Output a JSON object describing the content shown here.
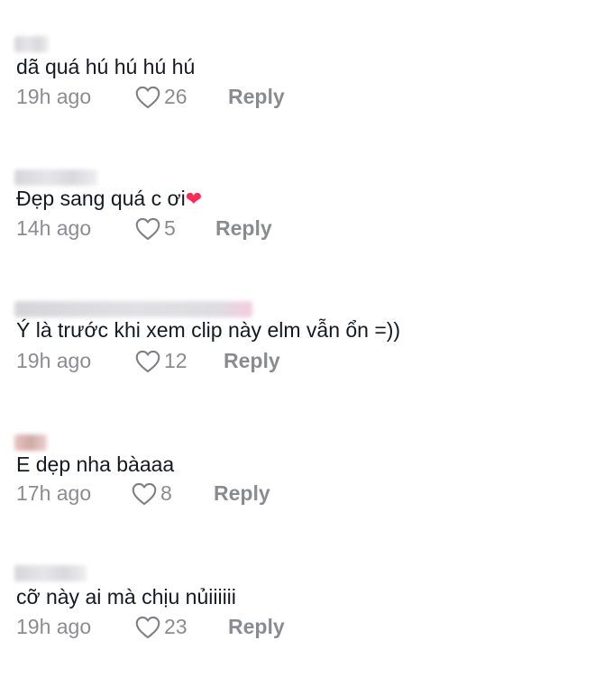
{
  "comments": [
    {
      "text": "dã quá hú hú hú hú",
      "time": "19h ago",
      "likes": "26",
      "reply": "Reply"
    },
    {
      "text": "Đẹp sang quá c ơi",
      "emoji": "❤",
      "time": "14h ago",
      "likes": "5",
      "reply": "Reply"
    },
    {
      "text": "Ý là trước khi xem clip này elm vẫn ổn =))",
      "time": "19h ago",
      "likes": "12",
      "reply": "Reply"
    },
    {
      "text": "E dẹp nha bàaaa",
      "time": "17h ago",
      "likes": "8",
      "reply": "Reply"
    },
    {
      "text": "cỡ này ai mà chịu nủiiiiii",
      "time": "19h ago",
      "likes": "23",
      "reply": "Reply"
    }
  ],
  "icons": {
    "like": "heart-outline-icon"
  },
  "colors": {
    "text": "#161823",
    "muted": "rgba(22,24,35,0.5)",
    "emoji": "#fe2c55"
  }
}
